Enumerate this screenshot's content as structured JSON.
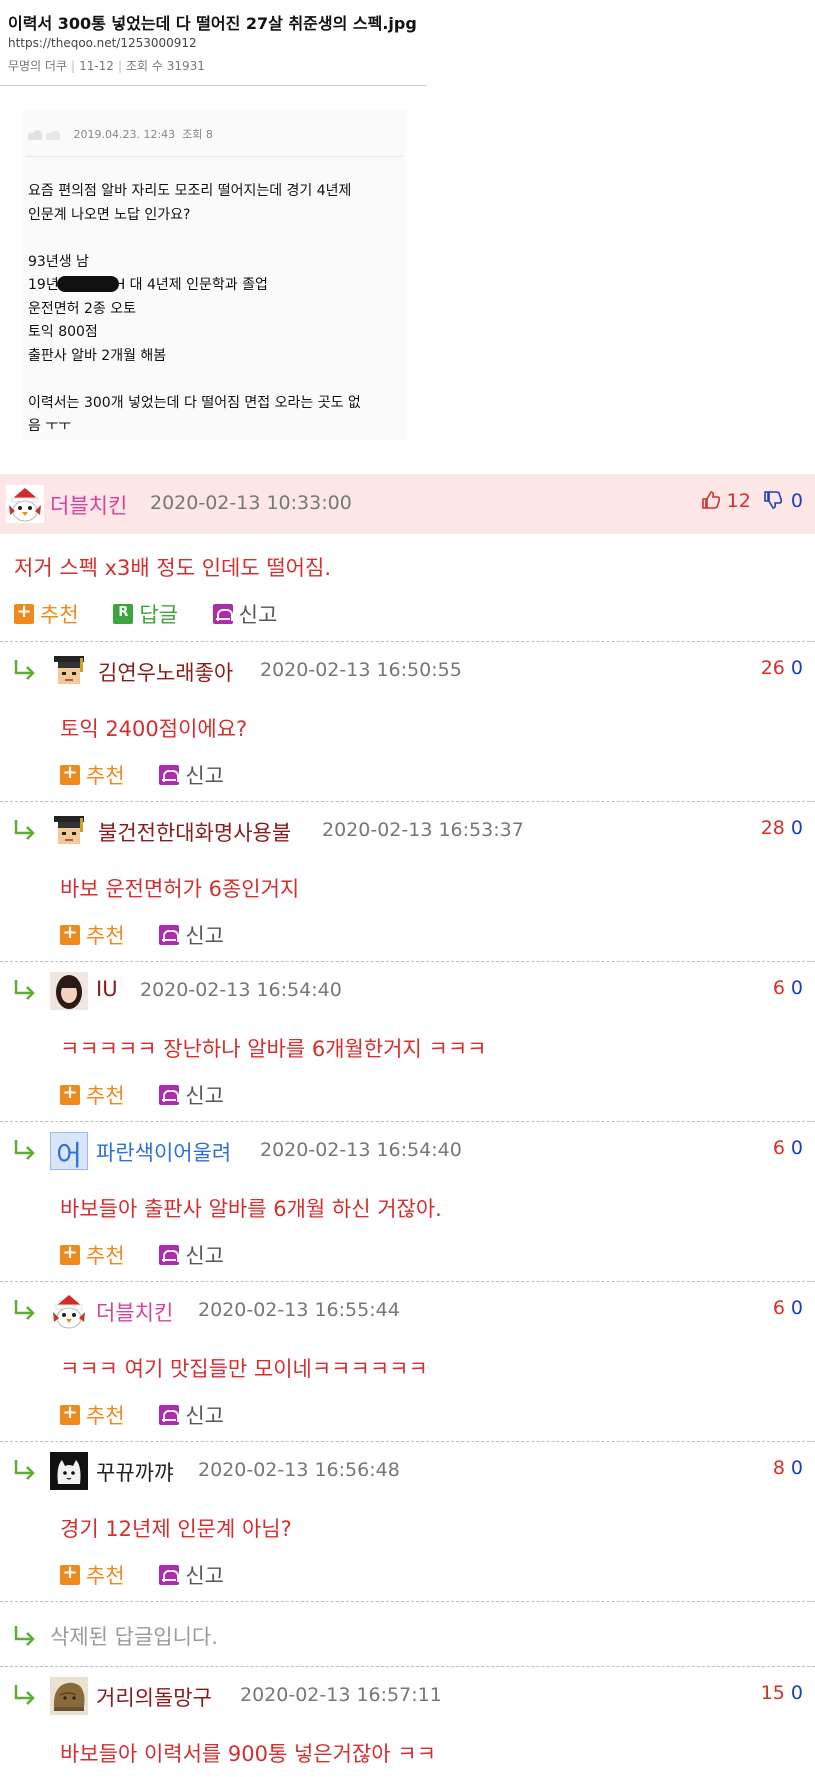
{
  "header": {
    "title": "이력서 300통 넣었는데 다 떨어진 27살 취준생의 스펙.jpg",
    "url": "https://theqoo.net/1253000912",
    "author": "무명의 더쿠",
    "date": "11-12",
    "views": "조회 수 31931"
  },
  "original_post": {
    "date": "2019.04.23. 12:43",
    "views": "조회 8",
    "lines": [
      "요즘 편의점 알바 자리도 모조리 떨어지는데 경기 4년제",
      "인문계 나오면 노답 인가요?",
      "",
      "93년생 남",
      "19년",
      "운전면허 2종 오토",
      "토익 800점",
      "출판사 알바 2개월 해봄",
      "",
      "이력서는 300개 넣었는데 다 떨어짐 면접 오라는 곳도 없",
      "음 ㅜㅜ"
    ],
    "line5_tail": "H 대 4년제 인문학과 졸업"
  },
  "actions": {
    "recommend": "추천",
    "reply": "답글",
    "report": "신고"
  },
  "comments": [
    {
      "nick": "더블치킨",
      "date": "2020-02-13 10:33:00",
      "up": "12",
      "down": "0",
      "text": "저거 스펙 x3배 정도 인데도 떨어짐."
    },
    {
      "nick": "김연우노래좋아",
      "date": "2020-02-13 16:50:55",
      "up": "26",
      "down": "0",
      "text": "토익 2400점이에요?"
    },
    {
      "nick": "불건전한대화명사용불",
      "date": "2020-02-13 16:53:37",
      "up": "28",
      "down": "0",
      "text": "바보 운전면허가 6종인거지"
    },
    {
      "nick": "IU",
      "date": "2020-02-13 16:54:40",
      "up": "6",
      "down": "0",
      "text": "ㅋㅋㅋㅋㅋ 장난하나 알바를 6개월한거지 ㅋㅋㅋ"
    },
    {
      "nick": "파란색이어울려",
      "date": "2020-02-13 16:54:40",
      "up": "6",
      "down": "0",
      "text": "바보들아 출판사 알바를 6개월 하신 거잖아.",
      "avatar_char": "어"
    },
    {
      "nick": "더블치킨",
      "date": "2020-02-13 16:55:44",
      "up": "6",
      "down": "0",
      "text": "ㅋㅋㅋ 여기 맛집들만 모이네ㅋㅋㅋㅋㅋㅋ"
    },
    {
      "nick": "꾸뀨까꺄",
      "date": "2020-02-13 16:56:48",
      "up": "8",
      "down": "0",
      "text": "경기 12년제 인문계 아님?"
    },
    {
      "nick": "거리의돌망구",
      "date": "2020-02-13 16:57:11",
      "up": "15",
      "down": "0",
      "text": "바보들아 이력서를 900통 넣은거잖아 ㅋㅋ"
    }
  ],
  "deleted_reply": "삭제된 답글입니다.",
  "colors": {
    "nick_pink": "#d6439e",
    "nick_dark": "#8b1a1a",
    "nick_blue": "#2f6fd8",
    "comment_text": "#d32f2f",
    "top_bg": "#fde6e6"
  }
}
